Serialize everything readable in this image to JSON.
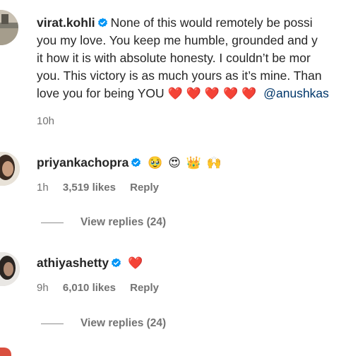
{
  "caption": {
    "username": "virat.kohli",
    "line1": "None of this would remotely be possi",
    "line2": "you my love. You keep me humble, grounded and y",
    "line3": "it how it is with absolute honesty. I couldn’t be mor",
    "line4": "you. This victory is as much yours as it’s mine. Than",
    "line5_start": "love you for being YOU",
    "hearts": [
      "❤️",
      "❤️",
      "❤️",
      "❤️",
      "❤️"
    ],
    "mention": "@anushkas",
    "time": "10h"
  },
  "comments": [
    {
      "username": "priyankachopra",
      "emojis": [
        "🥹",
        "😍",
        "👑",
        "🙌"
      ],
      "time": "1h",
      "likes": "3,519 likes",
      "reply": "Reply",
      "view_replies": "View replies (24)"
    },
    {
      "username": "athiyashetty",
      "emojis": [
        "❤️"
      ],
      "time": "9h",
      "likes": "6,010 likes",
      "reply": "Reply",
      "view_replies": "View replies (24)"
    }
  ],
  "colors": {
    "verified": "#0095f6",
    "mention": "#00376b",
    "heart": "#ed1c3a",
    "meta": "#737373"
  },
  "icons": {
    "verified": "verified-badge-icon"
  }
}
